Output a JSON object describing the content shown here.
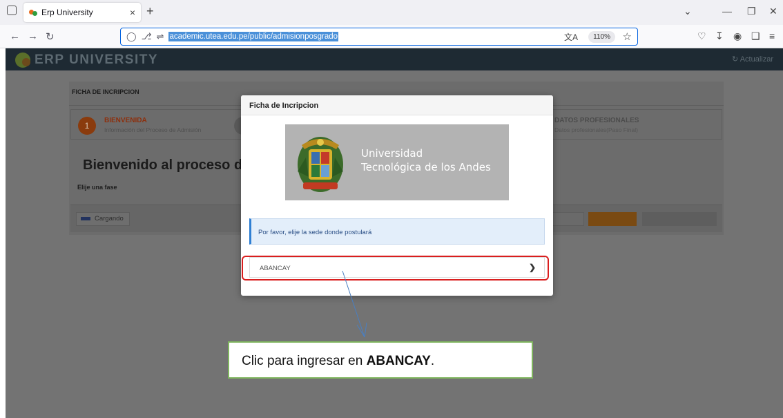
{
  "browser": {
    "tab_title": "Erp University",
    "tab_close": "×",
    "new_tab": "+",
    "url": "academic.utea.edu.pe/public/admisionposgrado",
    "zoom": "110%"
  },
  "app": {
    "brand": "ERP UNIVERSITY",
    "refresh": "Actualizar"
  },
  "page": {
    "section_title": "FICHA DE INCRIPCION",
    "step1_number": "1",
    "step1_title": "BIENVENIDA",
    "step1_sub": "Información del Proceso de Admisión",
    "step_last_title": "DATOS PROFESIONALES",
    "step_last_sub": "Datos profesionales(Paso Final)",
    "welcome": "Bienvenido al proceso de",
    "phase_label": "Elije una fase",
    "loading_label": "Cargando"
  },
  "modal": {
    "title": "Ficha de Incripcion",
    "university_line1": "Universidad",
    "university_line2": "Tecnológica de los Andes",
    "info": "Por favor, elije la sede donde postulará",
    "sede": "ABANCAY"
  },
  "callout": {
    "prefix": "Clic para ingresar en ",
    "bold": "ABANCAY",
    "suffix": "."
  },
  "colors": {
    "accent_red": "#d91e1e",
    "callout_border": "#7fb55e",
    "info_border": "#2f7fd3"
  }
}
